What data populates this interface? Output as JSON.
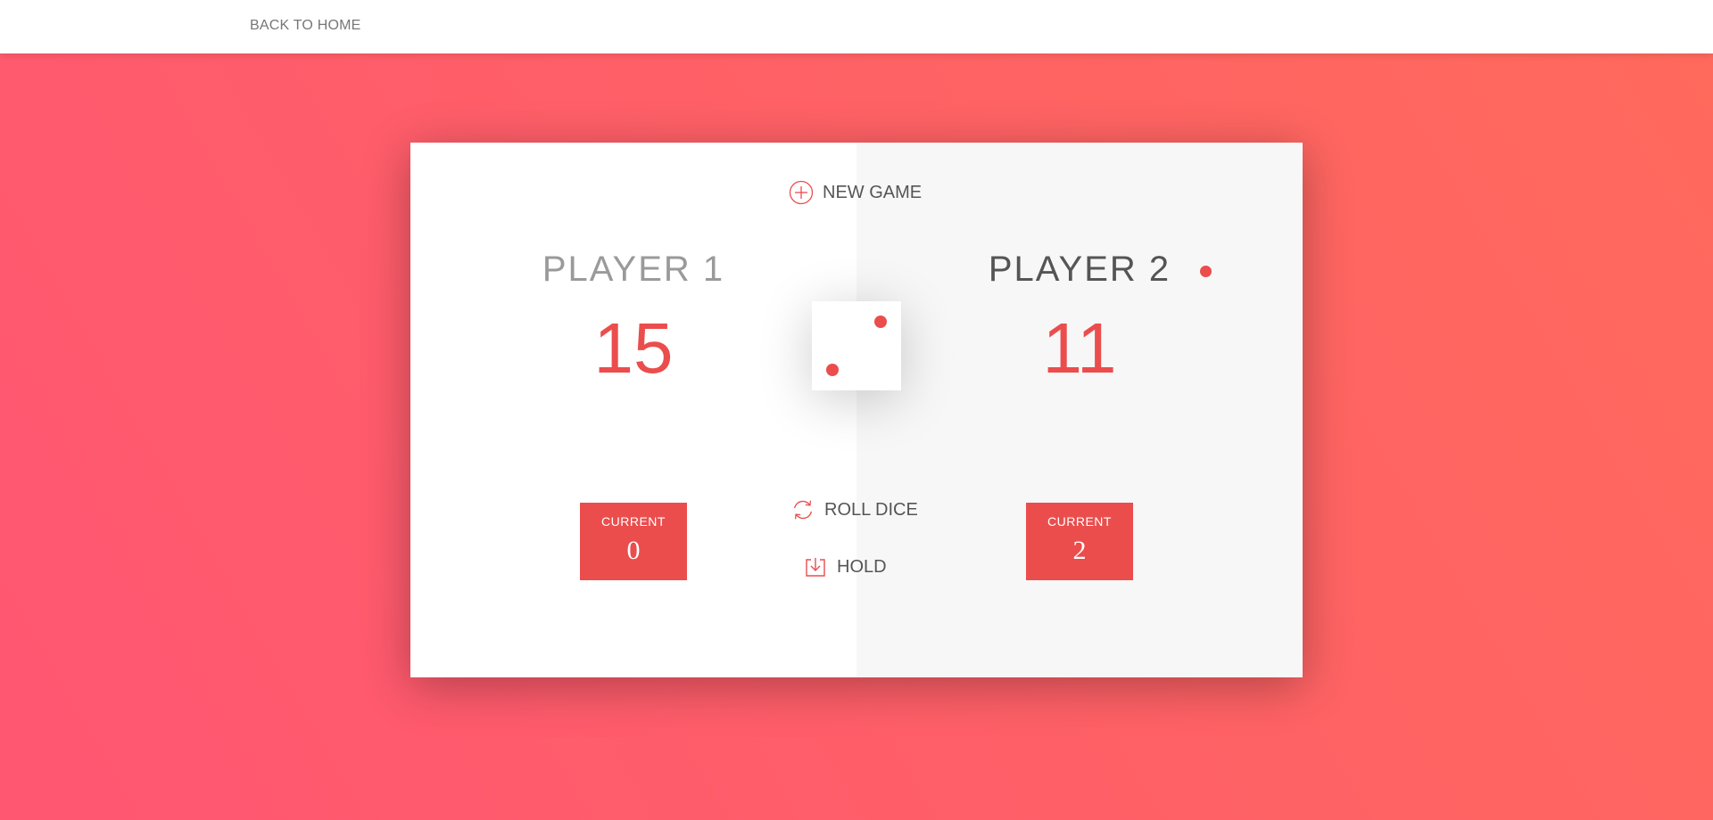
{
  "nav": {
    "back_label": "BACK TO HOME"
  },
  "game": {
    "new_game_label": "NEW GAME",
    "roll_label": "ROLL DICE",
    "hold_label": "HOLD",
    "active_player": 2,
    "dice_value": 2,
    "players": [
      {
        "name": "PLAYER 1",
        "score": "15",
        "current_label": "CURRENT",
        "current_score": "0"
      },
      {
        "name": "PLAYER 2",
        "score": "11",
        "current_label": "CURRENT",
        "current_score": "2"
      }
    ]
  },
  "colors": {
    "accent": "#eb4d4d",
    "background_start": "#ff5672",
    "background_end": "#ff6a5c"
  },
  "icons": {
    "new_game": "plus-circle-icon",
    "roll": "refresh-icon",
    "hold": "download-icon",
    "active": "active-dot-icon"
  }
}
